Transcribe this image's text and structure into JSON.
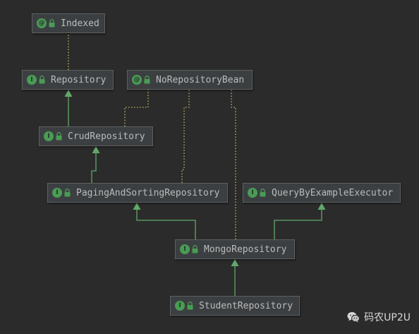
{
  "nodes": [
    {
      "id": "indexed",
      "label": "Indexed",
      "badge": "@"
    },
    {
      "id": "repository",
      "label": "Repository",
      "badge": "I"
    },
    {
      "id": "norepositorybean",
      "label": "NoRepositoryBean",
      "badge": "@"
    },
    {
      "id": "crudrepository",
      "label": "CrudRepository",
      "badge": "I"
    },
    {
      "id": "pagingandsortingrepository",
      "label": "PagingAndSortingRepository",
      "badge": "I"
    },
    {
      "id": "querybyexampleexecutor",
      "label": "QueryByExampleExecutor",
      "badge": "I"
    },
    {
      "id": "mongorepository",
      "label": "MongoRepository",
      "badge": "I"
    },
    {
      "id": "studentrepository",
      "label": "StudentRepository",
      "badge": "I"
    }
  ],
  "edges": [
    {
      "from": "repository",
      "to": "indexed",
      "kind": "annotation"
    },
    {
      "from": "crudrepository",
      "to": "repository",
      "kind": "extends"
    },
    {
      "from": "crudrepository",
      "to": "norepositorybean",
      "kind": "annotation"
    },
    {
      "from": "pagingandsortingrepository",
      "to": "crudrepository",
      "kind": "extends"
    },
    {
      "from": "pagingandsortingrepository",
      "to": "norepositorybean",
      "kind": "annotation"
    },
    {
      "from": "mongorepository",
      "to": "norepositorybean",
      "kind": "annotation"
    },
    {
      "from": "mongorepository",
      "to": "pagingandsortingrepository",
      "kind": "extends"
    },
    {
      "from": "mongorepository",
      "to": "querybyexampleexecutor",
      "kind": "extends"
    },
    {
      "from": "studentrepository",
      "to": "mongorepository",
      "kind": "extends"
    }
  ],
  "colors": {
    "background": "#2b2b2b",
    "node_fill": "#3c3f41",
    "node_border": "#5e6060",
    "text": "#bbbbbb",
    "badge": "#499c54",
    "extends_line": "#61a86a",
    "annotation_line": "#c8b96a"
  },
  "watermark": {
    "text": "码农UP2U",
    "icon": "wechat-icon"
  }
}
